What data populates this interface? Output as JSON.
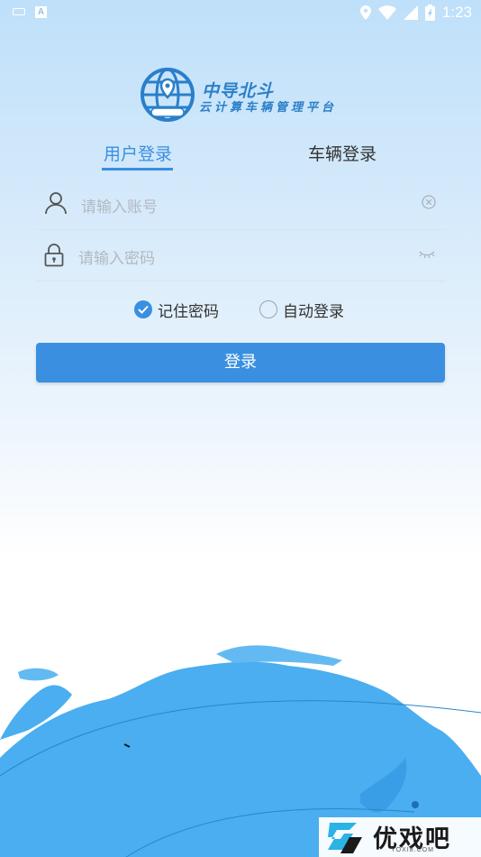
{
  "status_bar": {
    "ime_glyph": "A",
    "time": "1:23"
  },
  "logo": {
    "brand_name": "中导北斗",
    "subtitle": "云计算车辆管理平台"
  },
  "tabs": [
    {
      "label": "用户登录",
      "active": true
    },
    {
      "label": "车辆登录",
      "active": false
    }
  ],
  "form": {
    "account": {
      "value": "",
      "placeholder": "请输入账号"
    },
    "password": {
      "value": "",
      "placeholder": "请输入密码"
    }
  },
  "options": {
    "remember": {
      "label": "记住密码",
      "checked": true
    },
    "auto_login": {
      "label": "自动登录",
      "checked": false
    }
  },
  "login_button": {
    "label": "登录"
  },
  "watermark": {
    "title": "优戏吧",
    "sub": "YOXI8.COM"
  },
  "colors": {
    "accent": "#3a8fe0",
    "logo_blue": "#2b7fc9",
    "map_blue": "#4aaef0"
  }
}
